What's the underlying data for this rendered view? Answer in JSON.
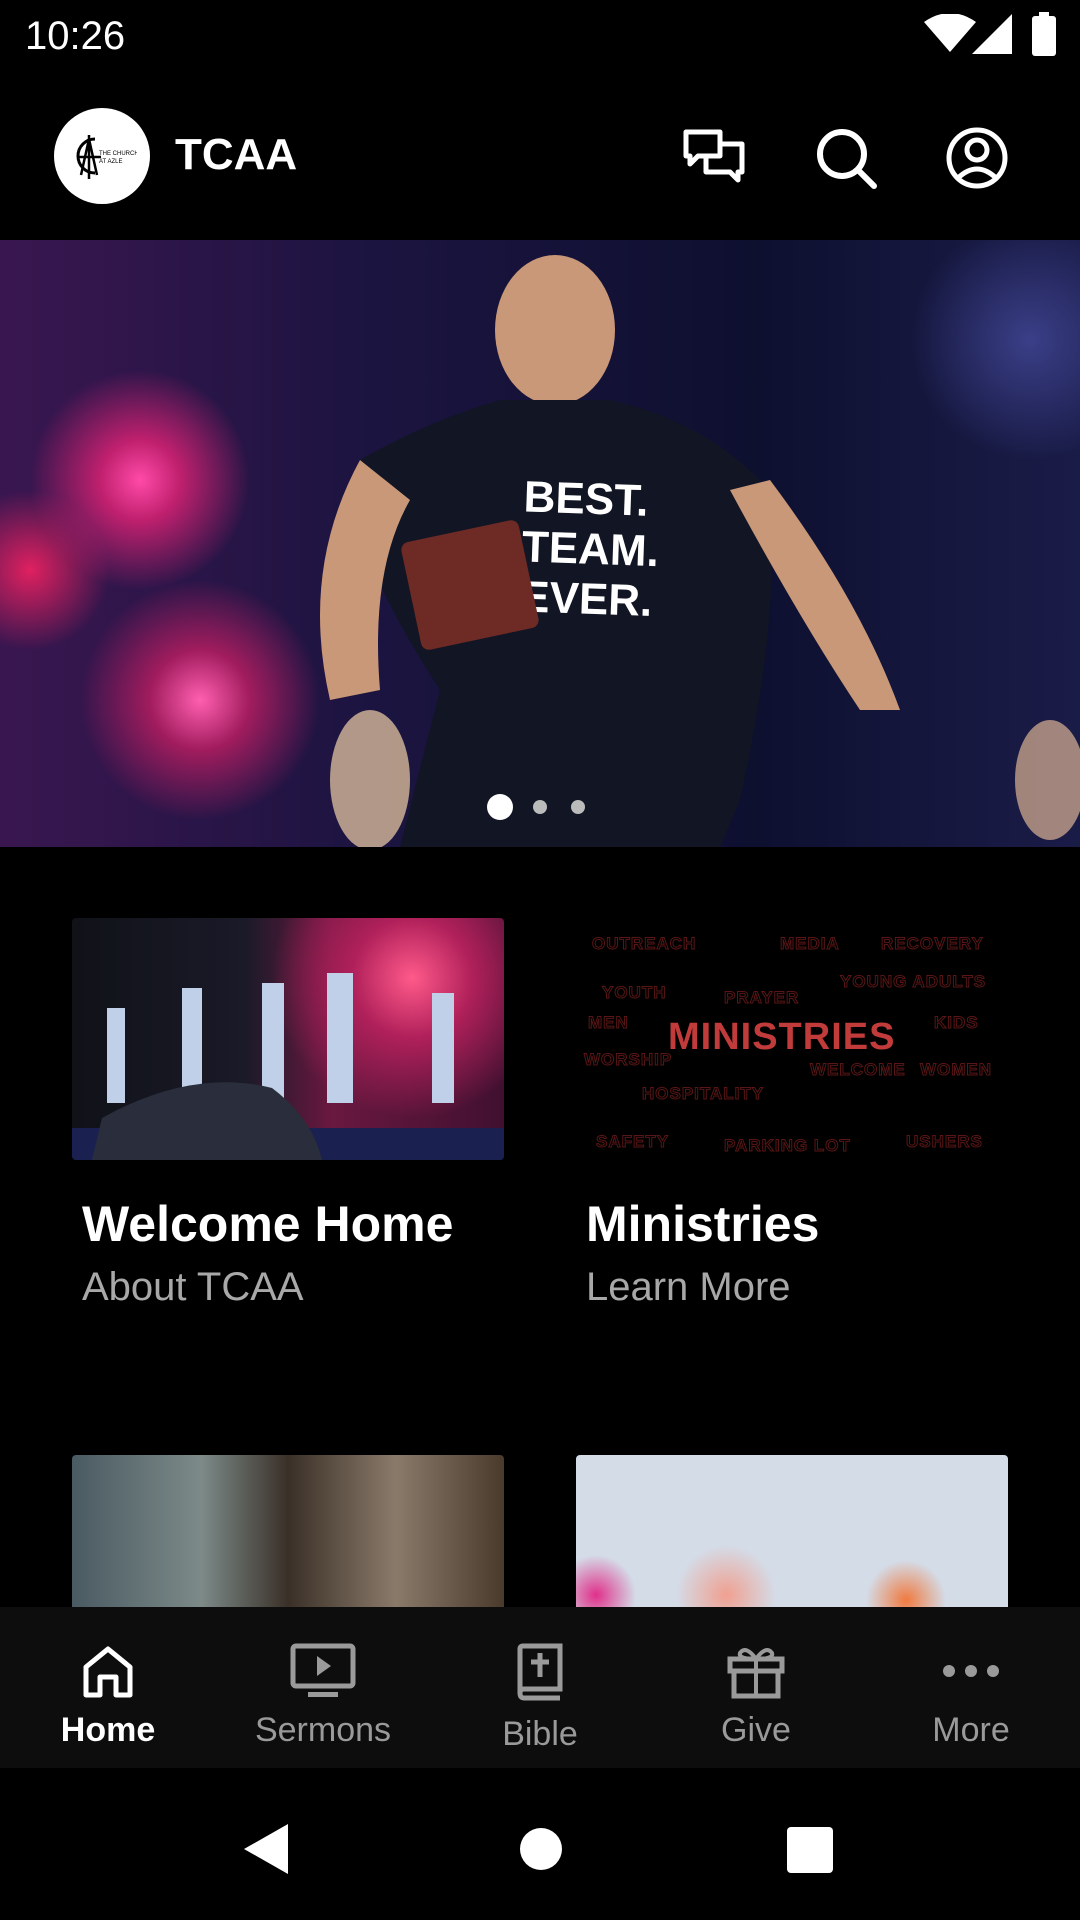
{
  "status_bar": {
    "time": "10:26",
    "icons": [
      "wifi-icon",
      "signal-icon",
      "battery-icon"
    ]
  },
  "header": {
    "logo_text": "THE CHURCH AT AZLE",
    "title": "TCAA",
    "icons": [
      "chat-icon",
      "search-icon",
      "account-icon"
    ]
  },
  "hero": {
    "slides": 3,
    "active_slide": 1,
    "shirt_text": "BEST. TEAM. EVER."
  },
  "cards": [
    {
      "title": "Welcome Home",
      "subtitle": "About TCAA"
    },
    {
      "title": "Ministries",
      "subtitle": "Learn More",
      "image_text": {
        "main": "MINISTRIES",
        "words": [
          "OUTREACH",
          "MEDIA",
          "RECOVERY",
          "YOUTH",
          "PRAYER",
          "YOUNG ADULTS",
          "MEN",
          "KIDS",
          "WORSHIP",
          "WELCOME",
          "WOMEN",
          "HOSPITALITY",
          "SAFETY",
          "PARKING LOT",
          "USHERS"
        ]
      }
    }
  ],
  "accent_color": "#c23b3b",
  "bottom_nav": [
    {
      "label": "Home",
      "icon": "home-icon",
      "active": true
    },
    {
      "label": "Sermons",
      "icon": "tv-play-icon"
    },
    {
      "label": "Bible",
      "icon": "bible-icon"
    },
    {
      "label": "Give",
      "icon": "gift-icon"
    },
    {
      "label": "More",
      "icon": "more-dots-icon"
    }
  ]
}
